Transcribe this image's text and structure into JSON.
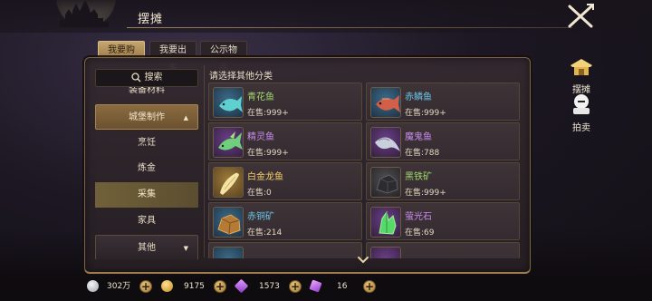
{
  "header": {
    "title": "摆摊"
  },
  "tabs": [
    {
      "label": "我要购买",
      "active": true
    },
    {
      "label": "我要出售",
      "active": false
    },
    {
      "label": "公示物品",
      "active": false
    }
  ],
  "search": {
    "label": "搜索"
  },
  "sidebar": {
    "items": [
      {
        "label": "装备材料"
      },
      {
        "label": "城堡制作"
      },
      {
        "label": "烹饪"
      },
      {
        "label": "炼金"
      },
      {
        "label": "采集"
      },
      {
        "label": "家具"
      },
      {
        "label": "其他"
      }
    ],
    "selected": "采集"
  },
  "prompt": "请选择其他分类",
  "stock_prefix": "在售:",
  "items": [
    {
      "name": "青花鱼",
      "stock": "999+",
      "quality": "green",
      "icon": "fish-icon"
    },
    {
      "name": "赤鳞鱼",
      "stock": "999+",
      "quality": "blue",
      "icon": "fish-icon"
    },
    {
      "name": "精灵鱼",
      "stock": "999+",
      "quality": "purple",
      "icon": "fish-icon"
    },
    {
      "name": "魔鬼鱼",
      "stock": "788",
      "quality": "purple",
      "icon": "ray-fish-icon"
    },
    {
      "name": "白金龙鱼",
      "stock": "0",
      "quality": "gold",
      "icon": "fish-icon"
    },
    {
      "name": "黑铁矿",
      "stock": "999+",
      "quality": "green",
      "icon": "ore-icon"
    },
    {
      "name": "赤铜矿",
      "stock": "214",
      "quality": "blue",
      "icon": "ore-icon"
    },
    {
      "name": "萤光石",
      "stock": "69",
      "quality": "purple",
      "icon": "crystal-icon"
    }
  ],
  "right_actions": [
    {
      "label": "摆摊",
      "icon": "stall-icon"
    },
    {
      "label": "拍卖",
      "icon": "auction-icon"
    }
  ],
  "currencies": [
    {
      "value": "302万",
      "icon": "silver-coin-icon",
      "color": "#c9ccd4"
    },
    {
      "value": "9175",
      "icon": "gold-coin-icon",
      "color": "#e8b84a"
    },
    {
      "value": "1573",
      "icon": "purple-gem-icon",
      "color": "#b86be0"
    },
    {
      "value": "16",
      "icon": "purple-crystal-icon",
      "color": "#c271e8"
    }
  ],
  "colors": {
    "accent": "#c6a66f",
    "quality_green": "#9fd66a",
    "quality_blue": "#6cc6e8",
    "quality_purple": "#c98cf0",
    "quality_gold": "#f3cf6c"
  }
}
